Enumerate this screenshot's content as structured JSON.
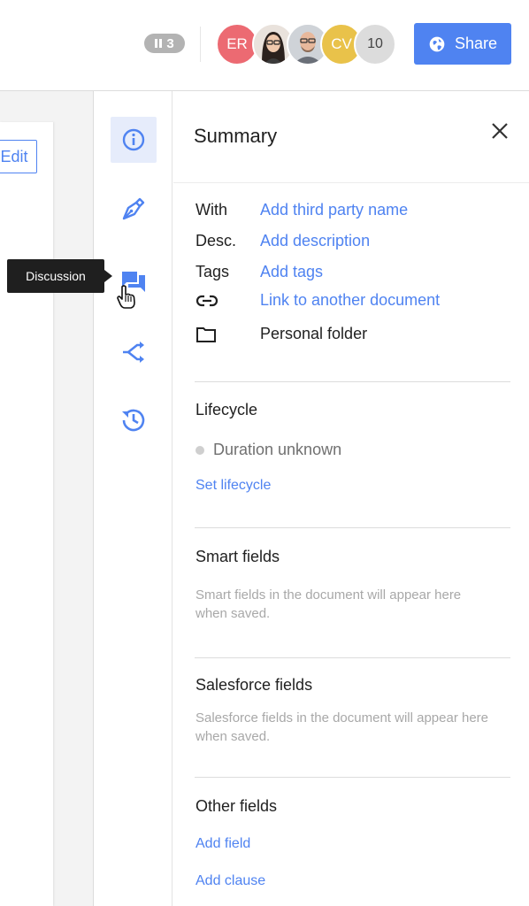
{
  "header": {
    "pause_count": "3",
    "collaborators": [
      {
        "initials": "ER",
        "color": "#ec6a72"
      },
      {
        "initials": "",
        "kind": "photo"
      },
      {
        "initials": "",
        "kind": "photo"
      },
      {
        "initials": "CV",
        "color": "#e9c24a"
      }
    ],
    "more_count": "10",
    "share_label": "Share"
  },
  "document": {
    "edit_label": "Edit"
  },
  "rail": {
    "items": [
      {
        "name": "info",
        "icon": "info-icon",
        "active": true
      },
      {
        "name": "sign",
        "icon": "pen-nib-icon"
      },
      {
        "name": "discussion",
        "icon": "chat-icon"
      },
      {
        "name": "workflow",
        "icon": "branch-icon"
      },
      {
        "name": "history",
        "icon": "history-icon"
      }
    ],
    "tooltip": "Discussion"
  },
  "panel": {
    "title": "Summary",
    "fields": {
      "with_label": "With",
      "with_value": "Add third party name",
      "desc_label": "Desc.",
      "desc_value": "Add description",
      "tags_label": "Tags",
      "tags_value": "Add tags",
      "link_value": "Link to another document",
      "folder_value": "Personal folder"
    },
    "lifecycle": {
      "title": "Lifecycle",
      "status": "Duration unknown",
      "action": "Set lifecycle"
    },
    "smart_fields": {
      "title": "Smart fields",
      "empty_text": "Smart fields in the document will appear here when saved."
    },
    "salesforce_fields": {
      "title": "Salesforce fields",
      "empty_text": "Salesforce fields in the document will appear here when saved."
    },
    "other_fields": {
      "title": "Other fields",
      "add_field": "Add field",
      "add_clause": "Add clause"
    }
  },
  "colors": {
    "accent": "#4f83f1",
    "active_bg": "#e6ecfb",
    "tooltip_bg": "#1f1f1f"
  }
}
